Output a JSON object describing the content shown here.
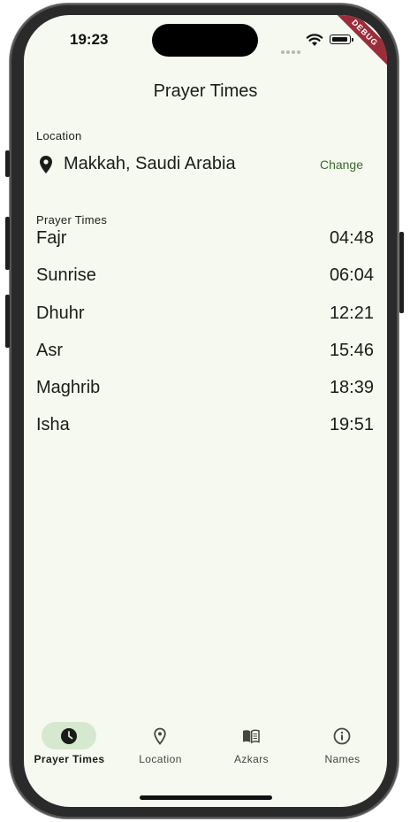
{
  "status_bar": {
    "time": "19:23",
    "debug_banner": "DEBUG"
  },
  "app_bar": {
    "title": "Prayer Times"
  },
  "location_section": {
    "label": "Location",
    "current_location": "Makkah, Saudi Arabia",
    "change_label": "Change"
  },
  "prayer_section": {
    "label": "Prayer Times",
    "prayers": [
      {
        "name": "Fajr",
        "time": "04:48"
      },
      {
        "name": "Sunrise",
        "time": "06:04"
      },
      {
        "name": "Dhuhr",
        "time": "12:21"
      },
      {
        "name": "Asr",
        "time": "15:46"
      },
      {
        "name": "Maghrib",
        "time": "18:39"
      },
      {
        "name": "Isha",
        "time": "19:51"
      }
    ]
  },
  "bottom_nav": {
    "items": [
      {
        "label": "Prayer Times",
        "icon": "clock-icon",
        "active": true
      },
      {
        "label": "Location",
        "icon": "location-pin-icon",
        "active": false
      },
      {
        "label": "Azkars",
        "icon": "book-icon",
        "active": false
      },
      {
        "label": "Names",
        "icon": "info-icon",
        "active": false
      }
    ]
  },
  "colors": {
    "background": "#f5f9f0",
    "accent": "#3b6b2c",
    "active_pill": "#d6e8cf",
    "debug_banner": "#9b2d3a"
  }
}
